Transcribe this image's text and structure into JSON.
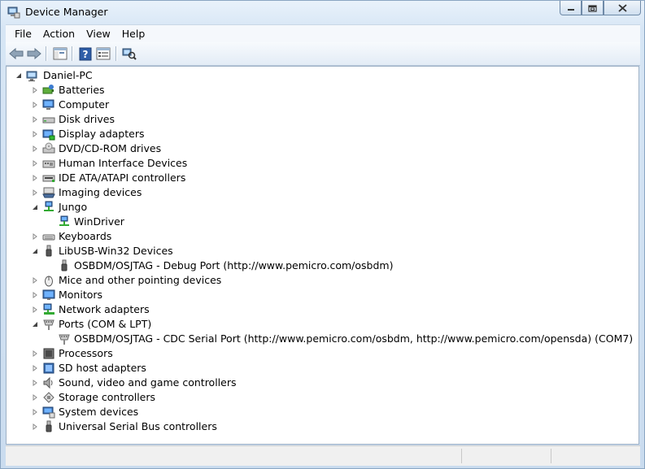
{
  "window": {
    "title": "Device Manager"
  },
  "menu": [
    "File",
    "Action",
    "View",
    "Help"
  ],
  "toolbar": {
    "buttons": [
      "back-icon",
      "forward-icon",
      "console-tree-icon",
      "help-icon",
      "properties-icon",
      "scan-hardware-icon"
    ]
  },
  "tree": {
    "root": "Daniel-PC",
    "items": [
      {
        "label": "Batteries",
        "icon": "battery-icon",
        "expanded": false
      },
      {
        "label": "Computer",
        "icon": "computer-icon",
        "expanded": false
      },
      {
        "label": "Disk drives",
        "icon": "disk-drive-icon",
        "expanded": false
      },
      {
        "label": "Display adapters",
        "icon": "display-adapter-icon",
        "expanded": false
      },
      {
        "label": "DVD/CD-ROM drives",
        "icon": "dvd-drive-icon",
        "expanded": false
      },
      {
        "label": "Human Interface Devices",
        "icon": "hid-icon",
        "expanded": false
      },
      {
        "label": "IDE ATA/ATAPI controllers",
        "icon": "ide-controller-icon",
        "expanded": false
      },
      {
        "label": "Imaging devices",
        "icon": "imaging-icon",
        "expanded": false
      },
      {
        "label": "Jungo",
        "icon": "network-icon",
        "expanded": true,
        "children": [
          {
            "label": "WinDriver",
            "icon": "network-icon"
          }
        ]
      },
      {
        "label": "Keyboards",
        "icon": "keyboard-icon",
        "expanded": false
      },
      {
        "label": "LibUSB-Win32 Devices",
        "icon": "usb-icon",
        "expanded": true,
        "children": [
          {
            "label": "OSBDM/OSJTAG - Debug Port (http://www.pemicro.com/osbdm)",
            "icon": "usb-icon"
          }
        ]
      },
      {
        "label": "Mice and other pointing devices",
        "icon": "mouse-icon",
        "expanded": false
      },
      {
        "label": "Monitors",
        "icon": "monitor-icon",
        "expanded": false
      },
      {
        "label": "Network adapters",
        "icon": "network-adapter-icon",
        "expanded": false
      },
      {
        "label": "Ports (COM & LPT)",
        "icon": "port-icon",
        "expanded": true,
        "children": [
          {
            "label": "OSBDM/OSJTAG - CDC Serial Port (http://www.pemicro.com/osbdm, http://www.pemicro.com/opensda) (COM7)",
            "icon": "port-icon"
          }
        ]
      },
      {
        "label": "Processors",
        "icon": "processor-icon",
        "expanded": false
      },
      {
        "label": "SD host adapters",
        "icon": "sd-host-icon",
        "expanded": false
      },
      {
        "label": "Sound, video and game controllers",
        "icon": "sound-icon",
        "expanded": false
      },
      {
        "label": "Storage controllers",
        "icon": "storage-icon",
        "expanded": false
      },
      {
        "label": "System devices",
        "icon": "system-icon",
        "expanded": false
      },
      {
        "label": "Universal Serial Bus controllers",
        "icon": "usb-icon",
        "expanded": false
      }
    ]
  },
  "colors": {
    "accent": "#3c7fb1",
    "window_frame": "#cadcef"
  }
}
